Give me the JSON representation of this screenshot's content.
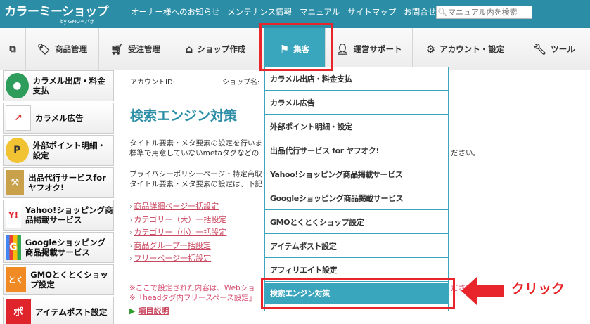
{
  "header": {
    "logo": "カラーミーショップ",
    "logo_sub": "by GMOペパボ",
    "links": [
      "オーナー様へのお知らせ",
      "メンテナンス情報",
      "マニュアル",
      "サイトマップ",
      "お問合せ"
    ],
    "search_placeholder": "マニュアル内を検索"
  },
  "nav": {
    "items": [
      {
        "label": "",
        "icon": "external-link-icon"
      },
      {
        "label": "商品管理",
        "icon": "tag-icon"
      },
      {
        "label": "受注管理",
        "icon": "cart-icon"
      },
      {
        "label": "ショップ作成",
        "icon": "home-icon"
      },
      {
        "label": "集客",
        "icon": "flag-icon",
        "active": true
      },
      {
        "label": "運営サポート",
        "icon": "user-icon"
      },
      {
        "label": "アカウント・設定",
        "icon": "gear-icon"
      },
      {
        "label": "ツール",
        "icon": "tools-icon"
      }
    ]
  },
  "sidebar": {
    "items": [
      {
        "label": "カラメル出店・料金支払",
        "icon": "caramel-icon"
      },
      {
        "label": "カラメル広告",
        "icon": "chart-icon"
      },
      {
        "label": "外部ポイント明細・設定",
        "icon": "point-icon"
      },
      {
        "label": "出品代行サービスfor ヤフオク!",
        "icon": "hammer-icon"
      },
      {
        "label": "Yahoo!ショッピング商品掲載サービス",
        "icon": "yahoo-icon"
      },
      {
        "label": "Googleショッピング商品掲載サービス",
        "icon": "google-icon"
      },
      {
        "label": "GMOとくとくショップ設定",
        "icon": "tokutoku-icon"
      },
      {
        "label": "アイテムポスト設定",
        "icon": "post-icon"
      }
    ]
  },
  "main": {
    "account_label": "アカウントID:",
    "shop_label": "ショップ名:",
    "title": "検索エンジン対策",
    "para1_line1": "タイトル要素・メタ要素の設定を行いま",
    "para1_line2": "標準で用意していないmetaタグなどの",
    "para1_right": "ださい。",
    "para2_line1": "プライバシーポリシーページ・特定商取",
    "para2_line2": "タイトル要素・メタ要素の設定は、下記",
    "links": [
      "商品詳細ページ一括設定",
      "カテゴリー（大）一括設定",
      "カテゴリー（小）一括設定",
      "商品グループ一括設定",
      "フリーページ一括設定"
    ],
    "note1": "※ここで設定された内容は、Webショ",
    "note1_right": "ださい。",
    "note2": "※「headタグ内フリースペース設定」",
    "explain": "項目説明"
  },
  "dropdown": {
    "items": [
      {
        "label": "カラメル出店・料金支払"
      },
      {
        "label": "カラメル広告"
      },
      {
        "label": "外部ポイント明細・設定"
      },
      {
        "label": "出品代行サービス for ヤフオク!"
      },
      {
        "label": "Yahoo!ショッピング商品掲載サービス"
      },
      {
        "label": "Googleショッピング商品掲載サービス"
      },
      {
        "label": "GMOとくとくショップ設定"
      },
      {
        "label": "アイテムポスト設定"
      },
      {
        "label": "アフィリエイト設定"
      },
      {
        "label": "検索エンジン対策",
        "selected": true
      }
    ]
  },
  "annotation": {
    "click_label": "クリック",
    "color": "#e8252a"
  },
  "colors": {
    "accent": "#2b8ea6",
    "active": "#3aa6bd",
    "link": "#c8465e"
  }
}
